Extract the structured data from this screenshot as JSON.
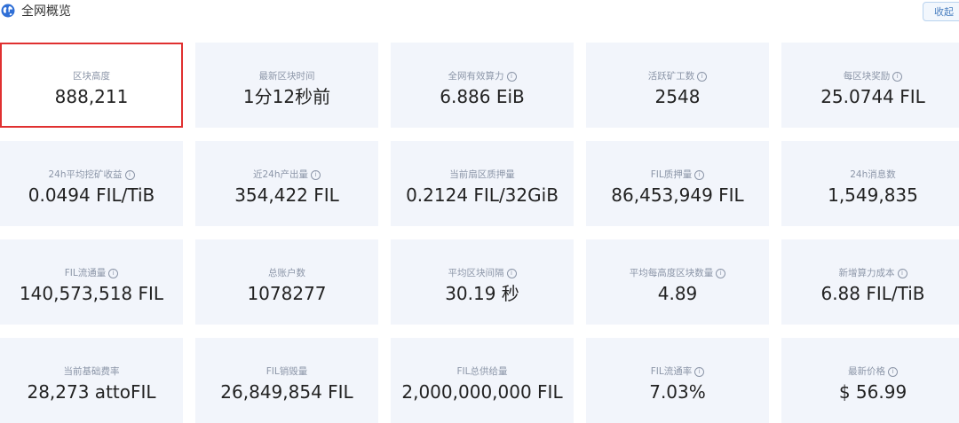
{
  "header": {
    "title": "全网概览",
    "collapse_label": "收起",
    "icon": "globe-icon",
    "icon_color": "#2f6fd6"
  },
  "stats": [
    {
      "label": "区块高度",
      "value": "888,211",
      "info": false,
      "selected": true
    },
    {
      "label": "最新区块时间",
      "value": "1分12秒前",
      "info": false
    },
    {
      "label": "全网有效算力",
      "value": "6.886 EiB",
      "info": true
    },
    {
      "label": "活跃矿工数",
      "value": "2548",
      "info": true
    },
    {
      "label": "每区块奖励",
      "value": "25.0744 FIL",
      "info": true
    },
    {
      "label": "24h平均挖矿收益",
      "value": "0.0494 FIL/TiB",
      "info": true
    },
    {
      "label": "近24h产出量",
      "value": "354,422 FIL",
      "info": true
    },
    {
      "label": "当前扇区质押量",
      "value": "0.2124 FIL/32GiB",
      "info": false
    },
    {
      "label": "FIL质押量",
      "value": "86,453,949 FIL",
      "info": true
    },
    {
      "label": "24h消息数",
      "value": "1,549,835",
      "info": false
    },
    {
      "label": "FIL流通量",
      "value": "140,573,518 FIL",
      "info": true
    },
    {
      "label": "总账户数",
      "value": "1078277",
      "info": false
    },
    {
      "label": "平均区块间隔",
      "value": "30.19 秒",
      "info": true
    },
    {
      "label": "平均每高度区块数量",
      "value": "4.89",
      "info": true
    },
    {
      "label": "新增算力成本",
      "value": "6.88 FIL/TiB",
      "info": true
    },
    {
      "label": "当前基础费率",
      "value": "28,273 attoFIL",
      "info": false
    },
    {
      "label": "FIL销毁量",
      "value": "26,849,854 FIL",
      "info": false
    },
    {
      "label": "FIL总供给量",
      "value": "2,000,000,000 FIL",
      "info": false
    },
    {
      "label": "FIL流通率",
      "value": "7.03%",
      "info": true
    },
    {
      "label": "最新价格",
      "value": "$ 56.99",
      "info": true
    }
  ],
  "colors": {
    "card_bg": "#f2f5fb",
    "selected_border": "#e03030",
    "label": "#8c96a8",
    "value": "#222222"
  }
}
